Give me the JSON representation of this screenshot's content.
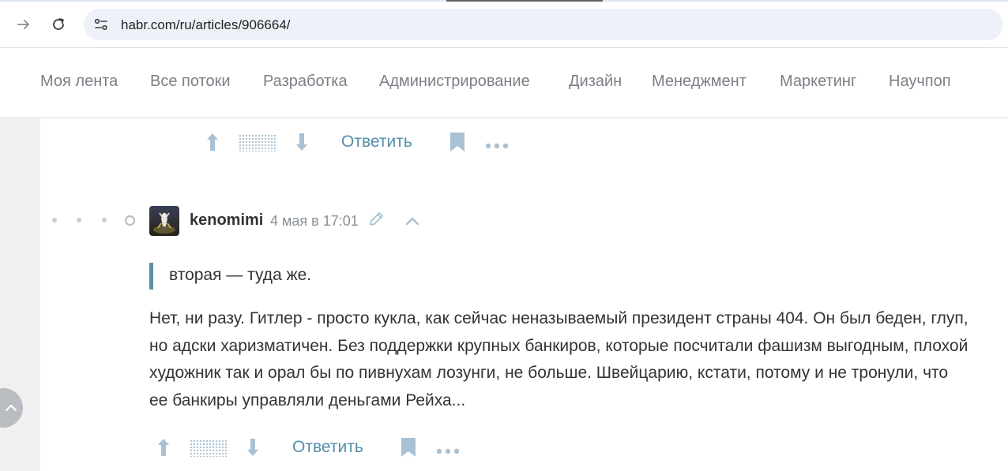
{
  "browser": {
    "url": "habr.com/ru/articles/906664/"
  },
  "nav": {
    "items": [
      "Моя лента",
      "Все потоки",
      "Разработка",
      "Администрирование",
      "Дизайн",
      "Менеджмент",
      "Маркетинг",
      "Научпоп"
    ]
  },
  "prev_comment": {
    "actions": {
      "reply_label": "Ответить"
    }
  },
  "comment": {
    "username": "kenomimi",
    "timestamp": "4 мая в 17:01",
    "quote": "вторая — туда же.",
    "body": "Нет, ни разу. Гитлер - просто кукла, как сейчас неназываемый президент страны 404. Он был беден, глуп, но адски харизматичен. Без поддержки крупных банкиров, которые посчитали фашизм выгодным, плохой художник так и орал бы по пивнухам лозунги, не больше. Швейцарию, кстати, потому и не тронули, что ее банкиры управляли деньгами Рейха...",
    "actions": {
      "reply_label": "Ответить"
    }
  },
  "colors": {
    "accent": "#548eaa",
    "icon": "#a9c1d2",
    "quote_bar": "#5e8ca6"
  }
}
